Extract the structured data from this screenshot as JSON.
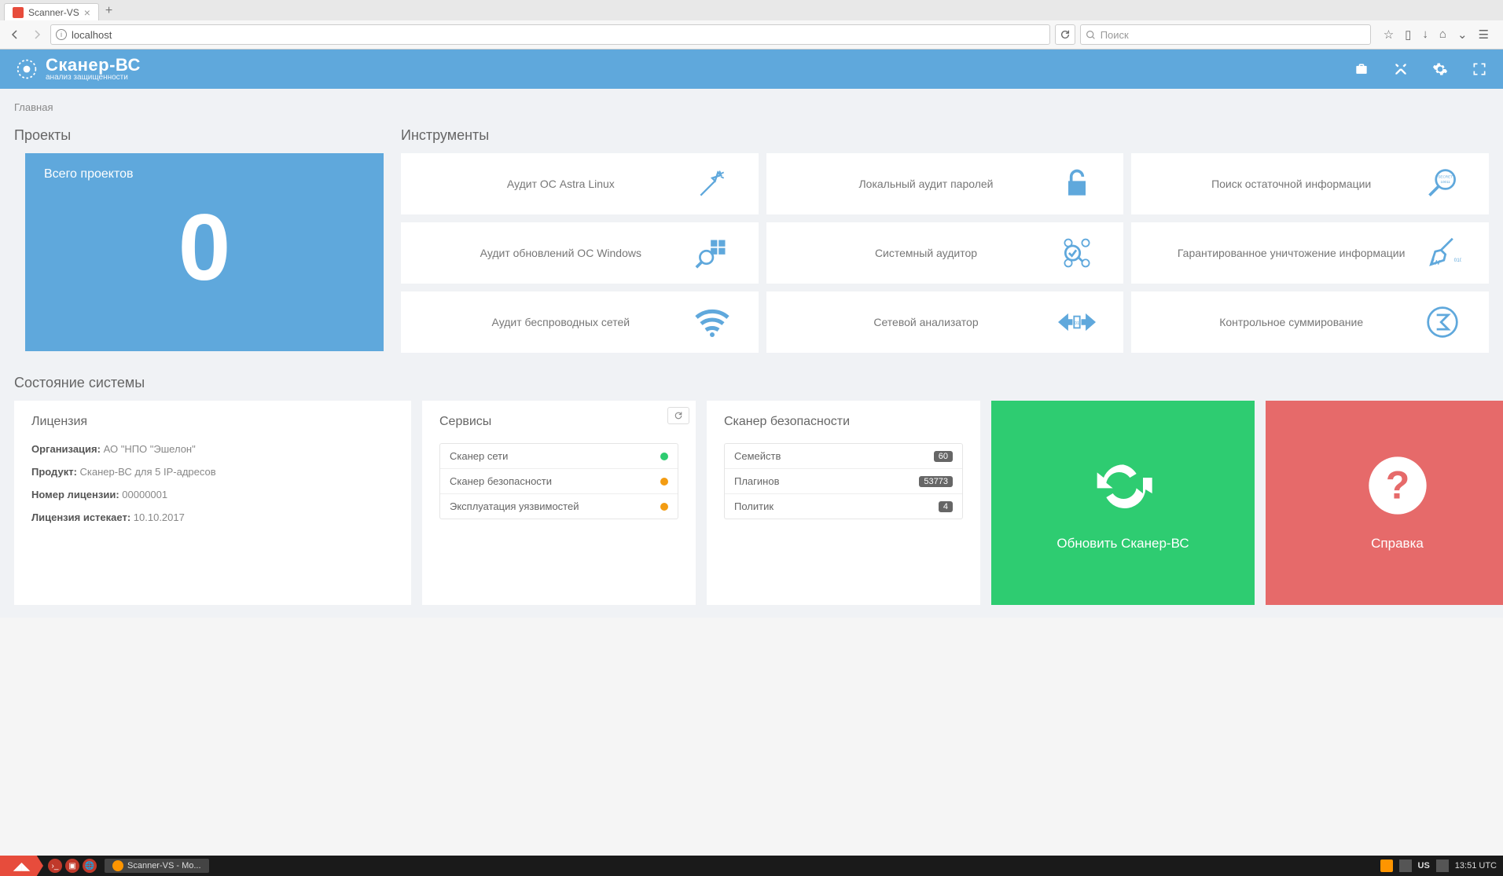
{
  "browser": {
    "tab_title": "Scanner-VS",
    "url": "localhost",
    "search_placeholder": "Поиск"
  },
  "header": {
    "title": "Сканер-ВС",
    "subtitle": "анализ защищенности"
  },
  "breadcrumb": "Главная",
  "projects": {
    "section_title": "Проекты",
    "label": "Всего проектов",
    "count": "0"
  },
  "tools": {
    "section_title": "Инструменты",
    "items": [
      "Аудит ОС Astra Linux",
      "Локальный аудит паролей",
      "Поиск остаточной информации",
      "Аудит обновлений ОС Windows",
      "Системный аудитор",
      "Гарантированное уничтожение информации",
      "Аудит беспроводных сетей",
      "Сетевой анализатор",
      "Контрольное суммирование"
    ]
  },
  "state": {
    "section_title": "Состояние системы",
    "license": {
      "title": "Лицензия",
      "org_label": "Организация:",
      "org_value": "АО \"НПО \"Эшелон\"",
      "product_label": "Продукт:",
      "product_value": "Сканер-ВС для 5 IP-адресов",
      "number_label": "Номер лицензии:",
      "number_value": "00000001",
      "expires_label": "Лицензия истекает:",
      "expires_value": "10.10.2017"
    },
    "services": {
      "title": "Сервисы",
      "items": [
        {
          "name": "Сканер сети",
          "status": "green"
        },
        {
          "name": "Сканер безопасности",
          "status": "orange"
        },
        {
          "name": "Эксплуатация уязвимостей",
          "status": "orange"
        }
      ]
    },
    "scanner": {
      "title": "Сканер безопасности",
      "items": [
        {
          "name": "Семейств",
          "value": "60"
        },
        {
          "name": "Плагинов",
          "value": "53773"
        },
        {
          "name": "Политик",
          "value": "4"
        }
      ]
    },
    "update_label": "Обновить Сканер-ВС",
    "help_label": "Справка"
  },
  "taskbar": {
    "task": "Scanner-VS - Mo...",
    "lang": "US",
    "time": "13:51 UTC"
  }
}
